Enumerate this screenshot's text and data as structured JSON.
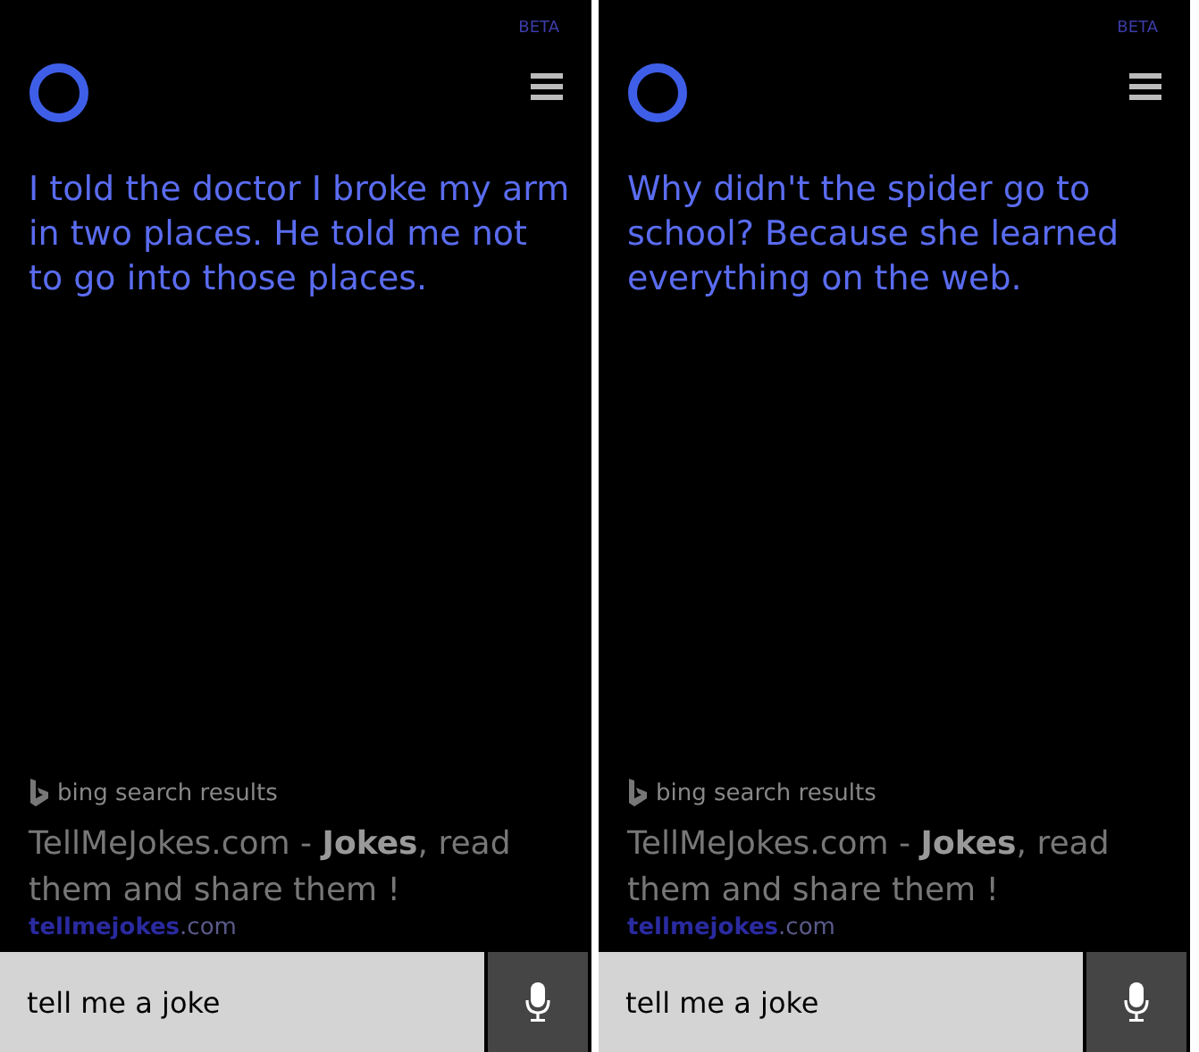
{
  "panels": [
    {
      "badge": "BETA",
      "answer": "I told the doctor I broke my arm in two places. He told me not to go into those places.",
      "source": "bing search results",
      "result": {
        "title": "TellMeJokes.com - **Jokes**, read them and share them !",
        "url": "**tellmejokes**.com"
      },
      "query": "tell me a joke"
    },
    {
      "badge": "BETA",
      "answer": "Why didn't the spider go to school? Because she learned everything on the web.",
      "source": "bing search results",
      "result": {
        "title": "TellMeJokes.com - **Jokes**, read them and share them !",
        "url": "**tellmejokes**.com"
      },
      "query": "tell me a joke"
    }
  ]
}
